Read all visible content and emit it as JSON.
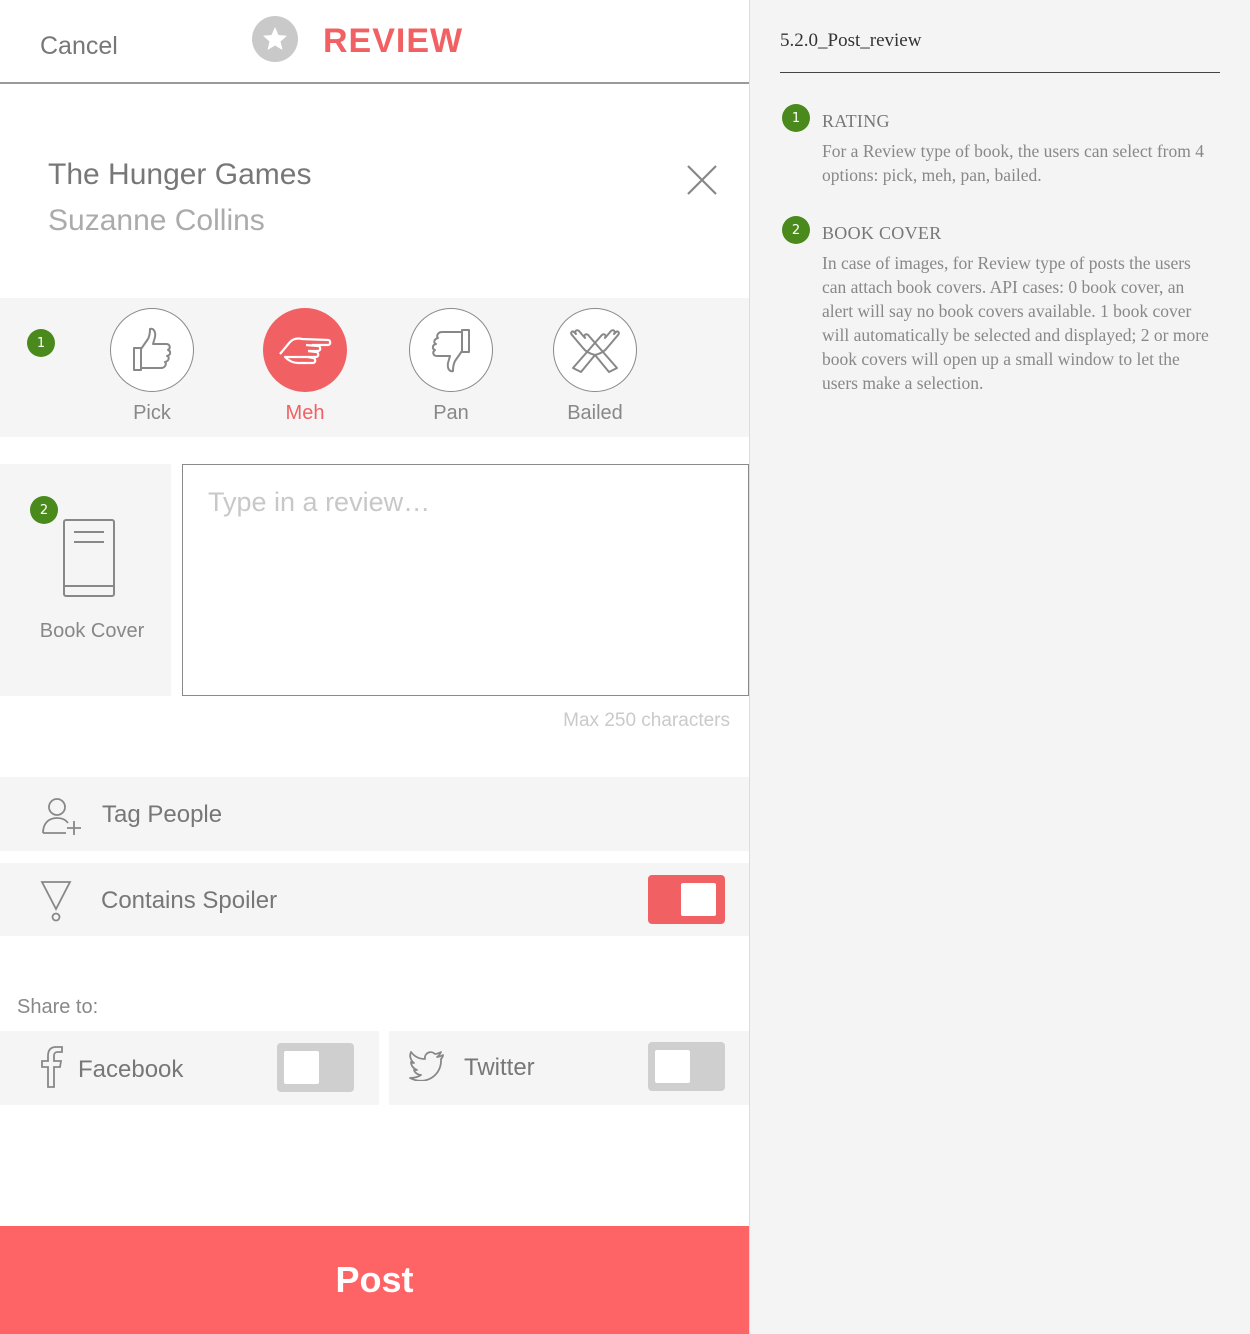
{
  "header": {
    "cancel_label": "Cancel",
    "title": "REVIEW"
  },
  "book": {
    "title": "The Hunger Games",
    "author": "Suzanne Collins"
  },
  "badges": {
    "rating": "1",
    "cover": "2"
  },
  "rating": {
    "options": [
      {
        "label": "Pick",
        "icon": "thumbs-up-icon"
      },
      {
        "label": "Meh",
        "icon": "hand-sideways-icon"
      },
      {
        "label": "Pan",
        "icon": "thumbs-down-icon"
      },
      {
        "label": "Bailed",
        "icon": "crossed-hands-icon"
      }
    ],
    "selected": "Meh"
  },
  "cover": {
    "label": "Book Cover"
  },
  "review": {
    "placeholder": "Type in a review…",
    "max_note": "Max 250 characters"
  },
  "tag_people": {
    "label": "Tag People"
  },
  "spoiler": {
    "label": "Contains Spoiler",
    "enabled": true
  },
  "share": {
    "label": "Share to:",
    "facebook": {
      "label": "Facebook",
      "enabled": false
    },
    "twitter": {
      "label": "Twitter",
      "enabled": false
    }
  },
  "post_label": "Post",
  "colors": {
    "accent": "#f16163",
    "badge": "#4a8a1c",
    "post": "#fe6466"
  },
  "notes": {
    "title": "5.2.0_Post_review",
    "items": [
      {
        "num": "1",
        "heading": "RATING",
        "body": "For a Review type of book, the users can select from 4 options: pick, meh, pan, bailed."
      },
      {
        "num": "2",
        "heading": "BOOK COVER",
        "body": "In case of images, for Review type of posts the users can attach book covers. API cases: 0 book cover, an alert will say no book covers available. 1 book cover will automatically be selected and displayed; 2 or more book covers will open up a small window to let the users make a selection."
      }
    ]
  }
}
